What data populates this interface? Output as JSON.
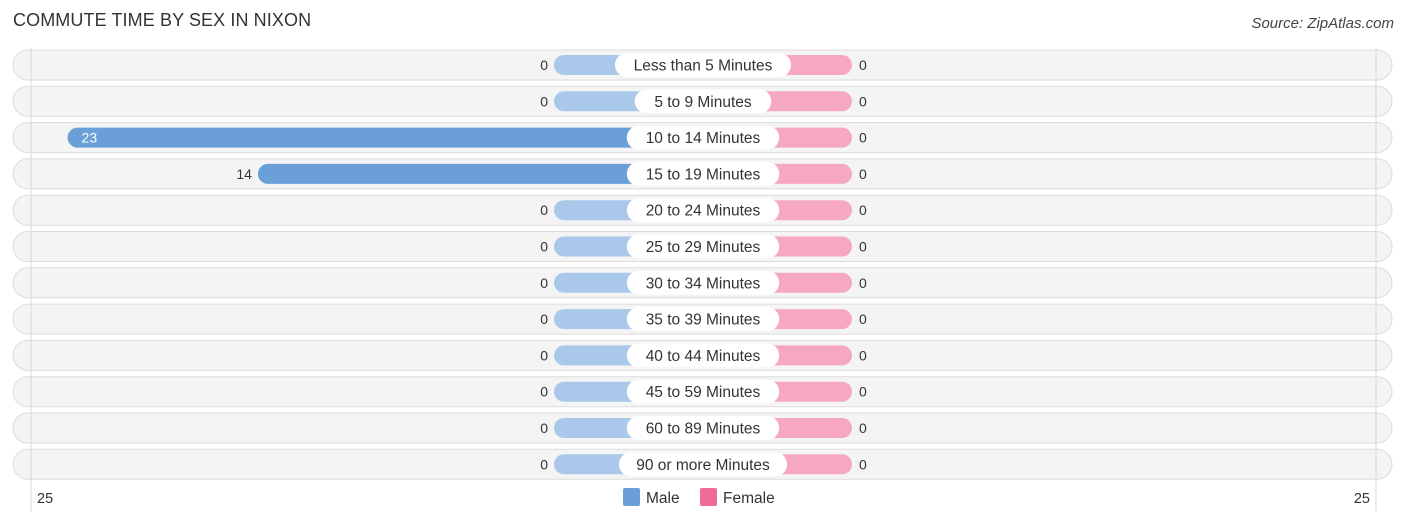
{
  "header": {
    "title": "COMMUTE TIME BY SEX IN NIXON",
    "source": "Source: ZipAtlas.com"
  },
  "colors": {
    "male": "#6a9fd8",
    "male_light": "#a9c8ea",
    "female": "#f07aa2",
    "female_light": "#f6a8c1",
    "legend_male": "#6a9fd8",
    "legend_female": "#f06b98"
  },
  "chart_data": {
    "type": "bar",
    "orientation": "horizontal-diverging",
    "title": "COMMUTE TIME BY SEX IN NIXON",
    "categories": [
      "Less than 5 Minutes",
      "5 to 9 Minutes",
      "10 to 14 Minutes",
      "15 to 19 Minutes",
      "20 to 24 Minutes",
      "25 to 29 Minutes",
      "30 to 34 Minutes",
      "35 to 39 Minutes",
      "40 to 44 Minutes",
      "45 to 59 Minutes",
      "60 to 89 Minutes",
      "90 or more Minutes"
    ],
    "series": [
      {
        "name": "Male",
        "values": [
          0,
          0,
          23,
          14,
          0,
          0,
          0,
          0,
          0,
          0,
          0,
          0
        ]
      },
      {
        "name": "Female",
        "values": [
          0,
          0,
          0,
          0,
          0,
          0,
          0,
          0,
          0,
          0,
          0,
          0
        ]
      }
    ],
    "axis": {
      "left_label": "25",
      "right_label": "25",
      "range": [
        -25,
        25
      ]
    },
    "legend": {
      "entries": [
        "Male",
        "Female"
      ],
      "position": "bottom-center"
    }
  }
}
